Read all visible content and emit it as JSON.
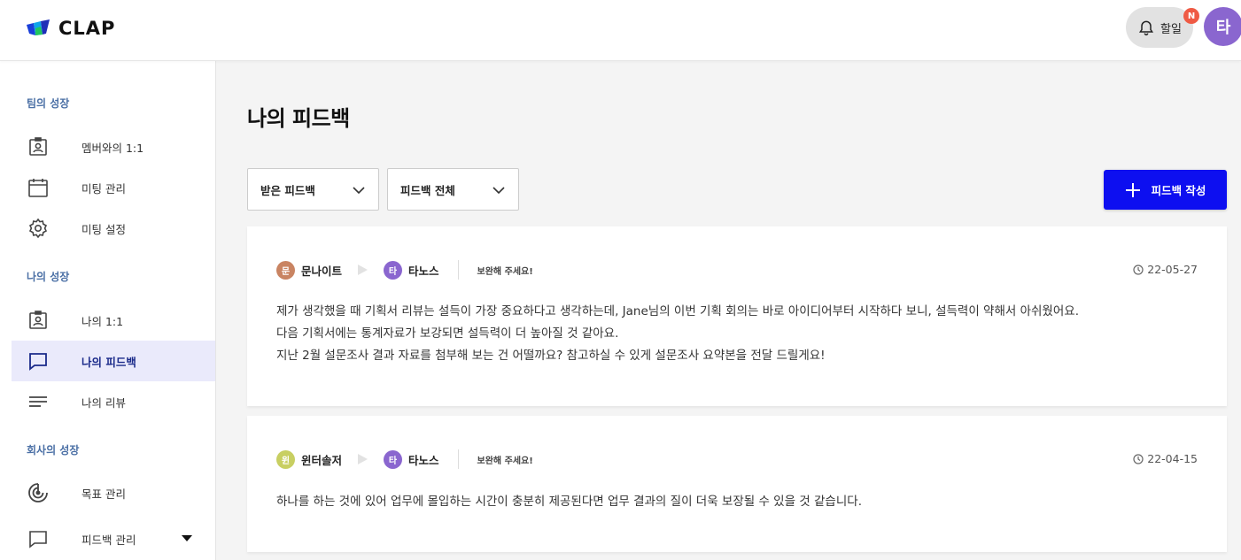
{
  "header": {
    "logo_text": "CLAP",
    "todo_label": "할일",
    "notification_badge": "N",
    "user_avatar_initial": "타",
    "colors": {
      "brand_blue": "#0d0ff0",
      "badge": "#ef5a44",
      "avatar": "#8a66cf"
    }
  },
  "sidebar": {
    "sections": [
      {
        "title": "팀의 성장"
      },
      {
        "title": "나의 성장"
      },
      {
        "title": "회사의 성장"
      }
    ],
    "items": [
      {
        "label": "멤버와의 1:1",
        "icon": "id-badge-icon"
      },
      {
        "label": "미팅 관리",
        "icon": "calendar-icon"
      },
      {
        "label": "미팅 설정",
        "icon": "gear-icon"
      },
      {
        "label": "나의 1:1",
        "icon": "id-badge-icon"
      },
      {
        "label": "나의 피드백",
        "icon": "chat-bubble-icon",
        "active": true
      },
      {
        "label": "나의 리뷰",
        "icon": "lines-icon"
      },
      {
        "label": "목표 관리",
        "icon": "target-icon"
      },
      {
        "label": "피드백 관리",
        "icon": "chat-bubble-icon",
        "has_dropdown": true
      }
    ]
  },
  "main": {
    "title": "나의 피드백",
    "filters": [
      {
        "selected": "받은 피드백"
      },
      {
        "selected": "피드백 전체"
      }
    ],
    "write_button_label": "피드백 작성",
    "feedbacks": [
      {
        "sender": {
          "name": "문나이트",
          "initial": "문",
          "color": "#c98462"
        },
        "receiver": {
          "name": "타노스",
          "initial": "타",
          "color": "#8a66cf"
        },
        "tag": "보완해 주세요!",
        "date": "22-05-27",
        "lines": [
          "제가 생각했을 때 기획서 리뷰는 설득이 가장 중요하다고 생각하는데, Jane님의 이번 기획 회의는 바로 아이디어부터 시작하다 보니, 설득력이 약해서 아쉬웠어요.",
          "다음 기획서에는 통계자료가 보강되면 설득력이 더 높아질 것 같아요.",
          "지난 2월 설문조사 결과 자료를 첨부해 보는 건 어떨까요? 참고하실 수 있게 설문조사 요약본을 전달 드릴게요!"
        ]
      },
      {
        "sender": {
          "name": "윈터솔저",
          "initial": "윈",
          "color": "#c8cf62"
        },
        "receiver": {
          "name": "타노스",
          "initial": "타",
          "color": "#8a66cf"
        },
        "tag": "보완해 주세요!",
        "date": "22-04-15",
        "lines": [
          "하나를 하는 것에 있어 업무에 몰입하는 시간이 충분히 제공된다면 업무 결과의 질이 더욱 보장될 수 있을 것 같습니다."
        ]
      }
    ]
  }
}
